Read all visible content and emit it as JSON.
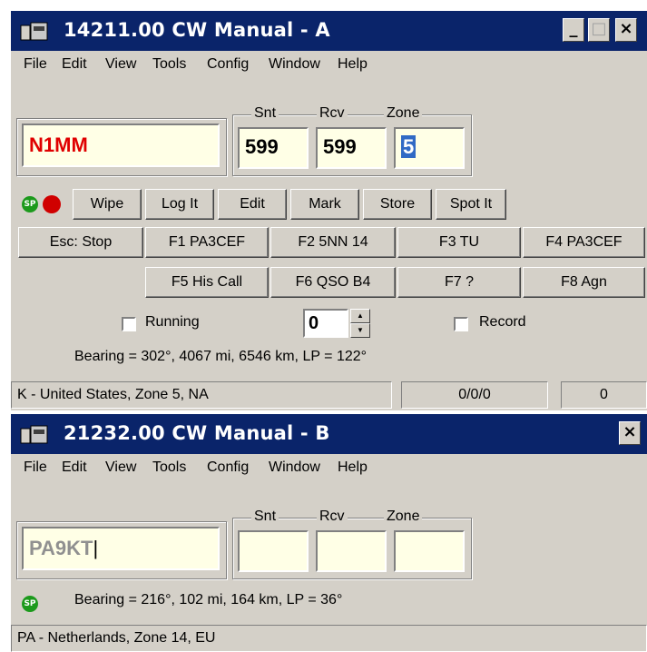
{
  "windowA": {
    "title": "14211.00 CW Manual - A",
    "controls": {
      "minimize": "_",
      "maximize": "□",
      "close": "×"
    },
    "menu": [
      "File",
      "Edit",
      "View",
      "Tools",
      "Config",
      "Window",
      "Help"
    ],
    "call_field": "N1MM",
    "exchange_labels": {
      "snt": "Snt",
      "rcv": "Rcv",
      "zone": "Zone"
    },
    "exchange_values": {
      "snt": "599",
      "rcv": "599",
      "zone": "5"
    },
    "sp_badge": "SP",
    "action_buttons": [
      "Wipe",
      "Log It",
      "Edit",
      "Mark",
      "Store",
      "Spot It"
    ],
    "function_keys_row1": [
      "Esc: Stop",
      "F1 PA3CEF",
      "F2 5NN 14",
      "F3 TU",
      "F4 PA3CEF"
    ],
    "function_keys_row2": [
      "F5 His Call",
      "F6 QSO B4",
      "F7 ?",
      "F8 Agn"
    ],
    "running_label": "Running",
    "spin_value": "0",
    "record_label": "Record",
    "bearing": "Bearing = 302°, 4067  mi, 6546 km, LP = 122°",
    "status": {
      "country": "K - United States, Zone 5, NA",
      "counts": "0/0/0",
      "extra": "0"
    }
  },
  "windowB": {
    "title": "21232.00 CW Manual - B",
    "controls": {
      "close": "×"
    },
    "menu": [
      "File",
      "Edit",
      "View",
      "Tools",
      "Config",
      "Window",
      "Help"
    ],
    "call_field": "PA9KT",
    "exchange_labels": {
      "snt": "Snt",
      "rcv": "Rcv",
      "zone": "Zone"
    },
    "sp_badge": "SP",
    "bearing": "Bearing = 216°, 102  mi, 164 km, LP = 36°",
    "status": {
      "country": "PA - Netherlands, Zone 14, EU"
    }
  },
  "colors": {
    "titlebar": "#0a246a",
    "call_red": "#e00000",
    "field_bg": "#ffffe6",
    "sp_green": "#1c9a1c"
  }
}
